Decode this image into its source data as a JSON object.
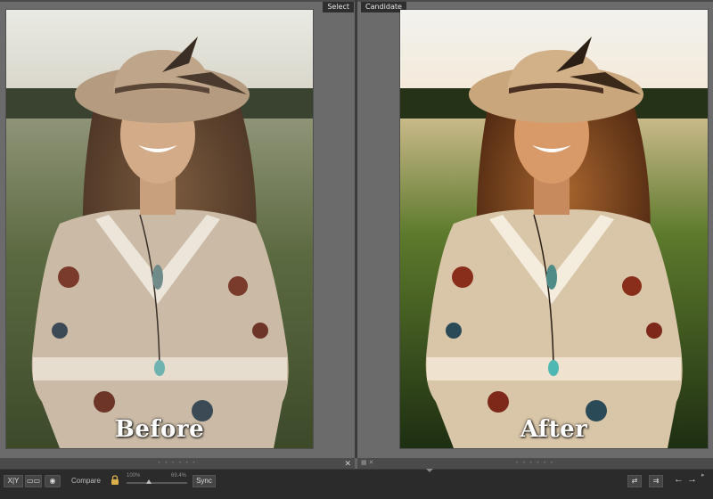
{
  "panes": {
    "select_label": "Select",
    "candidate_label": "Candidate"
  },
  "photos": {
    "before_caption": "Before",
    "after_caption": "After"
  },
  "toolbar": {
    "view_xy_label": "X|Y",
    "compare_label": "Compare",
    "zoom_left": "100%",
    "zoom_right": "69.4%",
    "sync_label": "Sync"
  },
  "icons": {
    "lock": "lock-icon",
    "close": "close-icon",
    "swap": "swap-icon",
    "copy": "copy-settings-icon",
    "prev": "arrow-left-icon",
    "next": "arrow-right-icon"
  }
}
